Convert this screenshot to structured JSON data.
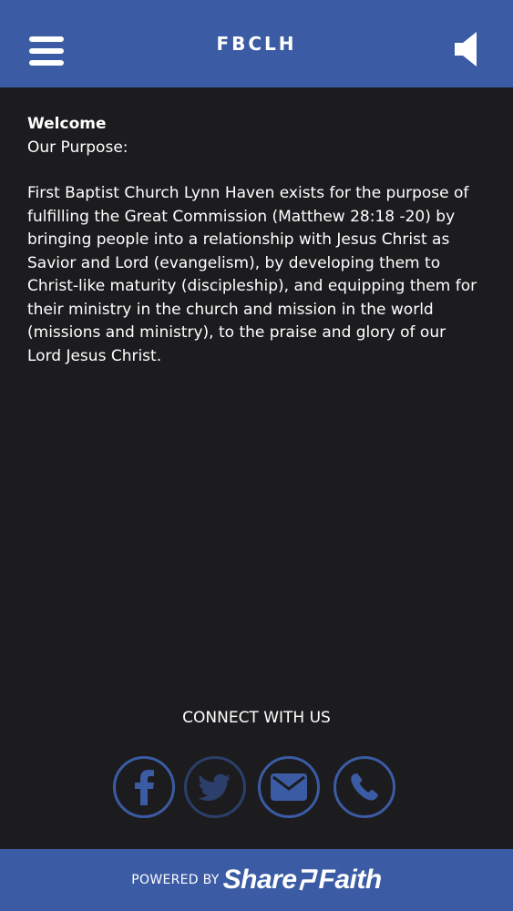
{
  "header": {
    "title": "FBCLH",
    "menu_icon": "hamburger-menu-icon",
    "sound_icon": "speaker-icon"
  },
  "content": {
    "heading": "Welcome",
    "purpose_label": "Our Purpose:",
    "paragraph": [
      "First Baptist Church Lynn Haven exists for the purpose of",
      "fulfilling the Great Commission (Matthew 28:18 -20) by",
      "bringing people into a relationship with Jesus Christ as",
      "Savior and Lord (evangelism), by developing them to",
      "Christ-like maturity (discipleship), and equipping them for",
      "their ministry in the church and mission in the world",
      "(missions and ministry), to the praise and glory of our",
      "Lord Jesus Christ."
    ]
  },
  "connect": {
    "label": "CONNECT WITH US",
    "links": [
      {
        "name": "facebook",
        "icon": "facebook-icon"
      },
      {
        "name": "twitter",
        "icon": "twitter-icon"
      },
      {
        "name": "email",
        "icon": "envelope-icon"
      },
      {
        "name": "phone",
        "icon": "phone-icon"
      }
    ]
  },
  "footer": {
    "powered_by": "POWERED BY",
    "brand_left": "Share",
    "brand_right": "Faith"
  },
  "colors": {
    "primary": "#3b5ba4",
    "background": "#1c1c1f",
    "text": "#ffffff"
  }
}
